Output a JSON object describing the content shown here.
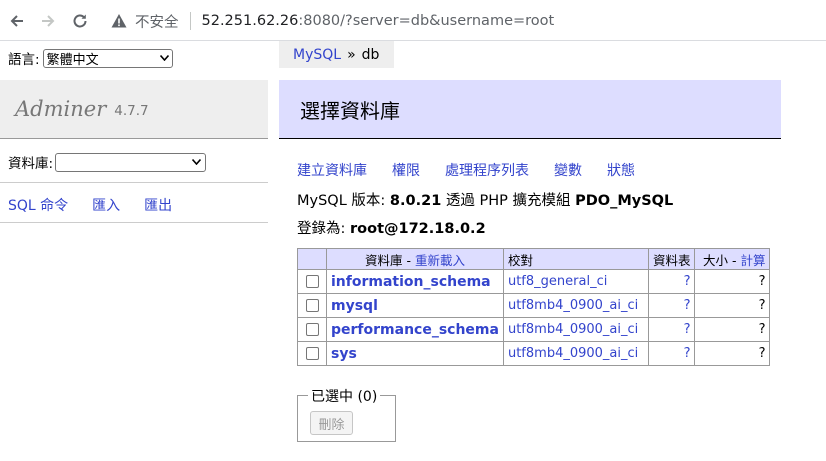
{
  "browser": {
    "insecure_label": "不安全",
    "url_host": "52.251.62.26",
    "url_rest": ":8080/?server=db&username=root"
  },
  "sidebar": {
    "lang_label": "語言:",
    "lang_value": "繁體中文",
    "app_name": "Adminer",
    "version": "4.7.7",
    "db_label": "資料庫:",
    "db_value": "",
    "links": [
      "SQL 命令",
      "匯入",
      "匯出"
    ]
  },
  "breadcrumb": {
    "server": "MySQL",
    "separator": "»",
    "current": "db"
  },
  "main": {
    "title": "選擇資料庫",
    "actions": [
      "建立資料庫",
      "權限",
      "處理程序列表",
      "變數",
      "狀態"
    ],
    "version_line": {
      "prefix": "MySQL 版本:",
      "version": "8.0.21",
      "middle": "透過 PHP 擴充模組",
      "ext": "PDO_MySQL"
    },
    "login_line": {
      "prefix": "登錄為:",
      "user": "root@172.18.0.2"
    },
    "table": {
      "headers": {
        "database": "資料庫",
        "dash": " - ",
        "reload": "重新載入",
        "collation": "校對",
        "tables": "資料表",
        "size": "大小",
        "compute": "計算"
      },
      "rows": [
        {
          "name": "information_schema",
          "collation": "utf8_general_ci",
          "tables": "?",
          "size": "?"
        },
        {
          "name": "mysql",
          "collation": "utf8mb4_0900_ai_ci",
          "tables": "?",
          "size": "?"
        },
        {
          "name": "performance_schema",
          "collation": "utf8mb4_0900_ai_ci",
          "tables": "?",
          "size": "?"
        },
        {
          "name": "sys",
          "collation": "utf8mb4_0900_ai_ci",
          "tables": "?",
          "size": "?"
        }
      ]
    },
    "selected": {
      "legend": "已選中 (0)",
      "delete_label": "刪除"
    }
  },
  "colors": {
    "link": "#3333cc",
    "heading_bg": "#ddddff",
    "sidebar_bg": "#eeeeee"
  }
}
